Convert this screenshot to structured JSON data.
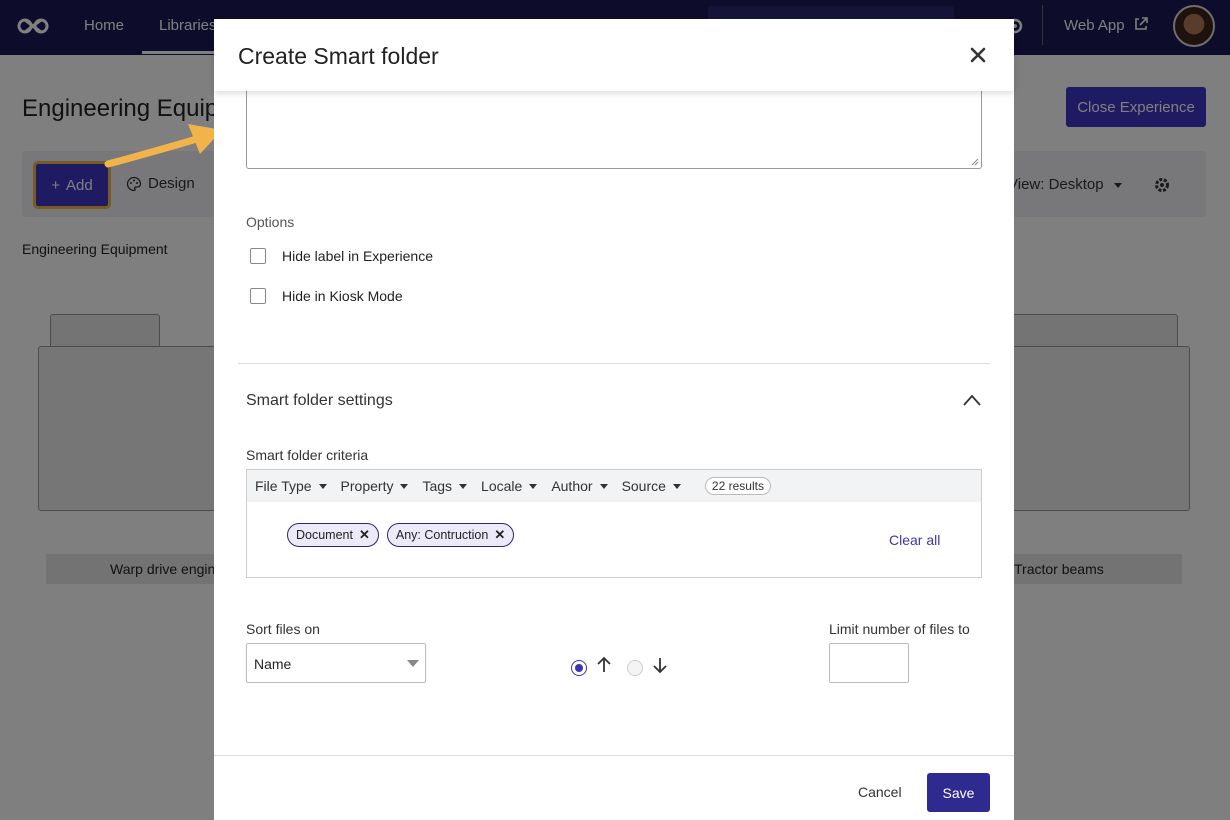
{
  "nav": {
    "home": "Home",
    "libraries": "Libraries",
    "web_app": "Web App"
  },
  "page": {
    "title": "Engineering Equipr",
    "close_experience": "Close Experience",
    "add_label": "Add",
    "design_label": "Design",
    "view_label": "View: Desktop",
    "breadcrumb": "Engineering Equipment",
    "folders": [
      {
        "label": "Warp drive engin"
      },
      {
        "label": "Tractor beams"
      }
    ]
  },
  "modal": {
    "title": "Create Smart folder",
    "options_label": "Options",
    "options": [
      {
        "label": "Hide label in Experience",
        "checked": false
      },
      {
        "label": "Hide in Kiosk Mode",
        "checked": false
      }
    ],
    "section_title": "Smart folder settings",
    "criteria_label": "Smart folder criteria",
    "filters": [
      "File Type",
      "Property",
      "Tags",
      "Locale",
      "Author",
      "Source"
    ],
    "results": "22 results",
    "chips": [
      "Document",
      "Any: Contruction"
    ],
    "clear_all": "Clear all",
    "sort_label": "Sort files on",
    "sort_value": "Name",
    "sort_order": "ascending",
    "limit_label": "Limit number of files to",
    "limit_value": "",
    "cancel": "Cancel",
    "save": "Save"
  },
  "colors": {
    "nav_bg": "#1b1a57",
    "primary": "#3d36c7",
    "highlight": "#f2b44a",
    "save_bg": "#2f2a8f"
  },
  "icons": {
    "logo": "infinity-logo-icon",
    "gear": "gear-icon",
    "external": "external-link-icon",
    "palette": "palette-icon",
    "close": "close-icon",
    "chevron_up": "chevron-up-icon",
    "arrow_up": "arrow-up-icon",
    "arrow_down": "arrow-down-icon"
  }
}
